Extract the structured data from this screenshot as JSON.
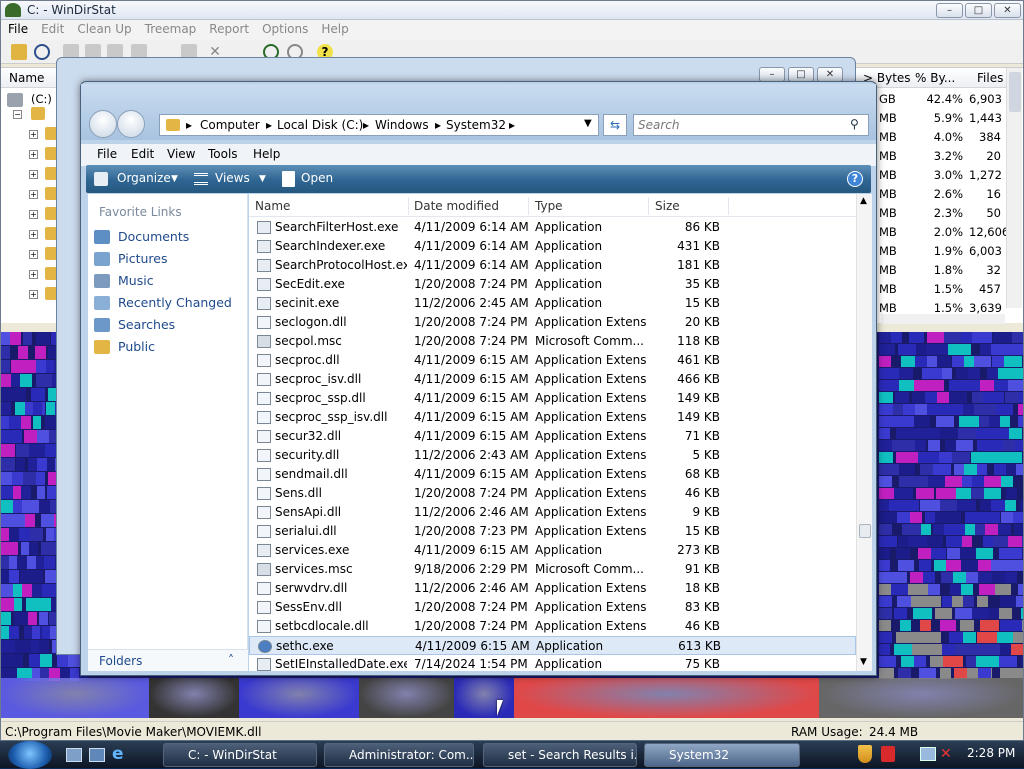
{
  "windirstat": {
    "title": "C: - WinDirStat",
    "menu": [
      "File",
      "Edit",
      "Clean Up",
      "Treemap",
      "Report",
      "Options",
      "Help"
    ],
    "list_headers": {
      "name": "Name",
      "bytes": "> Bytes",
      "pct_bytes": "% By...",
      "files": "Files"
    },
    "drive": "(C:)",
    "rows": [
      {
        "size": "GB",
        "pct": "42.4%",
        "files": "6,903"
      },
      {
        "size": "MB",
        "pct": "5.9%",
        "files": "1,443"
      },
      {
        "size": "MB",
        "pct": "4.0%",
        "files": "384"
      },
      {
        "size": "MB",
        "pct": "3.2%",
        "files": "20"
      },
      {
        "size": "MB",
        "pct": "3.0%",
        "files": "1,272"
      },
      {
        "size": "MB",
        "pct": "2.6%",
        "files": "16"
      },
      {
        "size": "MB",
        "pct": "2.3%",
        "files": "50"
      },
      {
        "size": "MB",
        "pct": "2.0%",
        "files": "12,606"
      },
      {
        "size": "MB",
        "pct": "1.9%",
        "files": "6,003"
      },
      {
        "size": "MB",
        "pct": "1.8%",
        "files": "32"
      },
      {
        "size": "MB",
        "pct": "1.5%",
        "files": "457"
      },
      {
        "size": "MB",
        "pct": "1.5%",
        "files": "3,639"
      }
    ],
    "status_path": "C:\\Program Files\\Movie Maker\\MOVIEMK.dll",
    "ram_label": "RAM Usage:",
    "ram_value": "24.4 MB"
  },
  "explorer": {
    "breadcrumb": [
      "Computer",
      "Local Disk (C:)",
      "Windows",
      "System32"
    ],
    "search_placeholder": "Search",
    "menu": [
      "File",
      "Edit",
      "View",
      "Tools",
      "Help"
    ],
    "commands": {
      "organize": "Organize",
      "views": "Views",
      "open": "Open"
    },
    "favorite_links_title": "Favorite Links",
    "favorite_links": [
      "Documents",
      "Pictures",
      "Music",
      "Recently Changed",
      "Searches",
      "Public"
    ],
    "folders_label": "Folders",
    "columns": {
      "name": "Name",
      "date": "Date modified",
      "type": "Type",
      "size": "Size"
    },
    "files": [
      {
        "name": "SearchFilterHost.exe",
        "date": "4/11/2009 6:14 AM",
        "type": "Application",
        "size": "86 KB"
      },
      {
        "name": "SearchIndexer.exe",
        "date": "4/11/2009 6:14 AM",
        "type": "Application",
        "size": "431 KB"
      },
      {
        "name": "SearchProtocolHost.exe",
        "date": "4/11/2009 6:14 AM",
        "type": "Application",
        "size": "181 KB"
      },
      {
        "name": "SecEdit.exe",
        "date": "1/20/2008 7:24 PM",
        "type": "Application",
        "size": "35 KB"
      },
      {
        "name": "secinit.exe",
        "date": "11/2/2006 2:45 AM",
        "type": "Application",
        "size": "15 KB"
      },
      {
        "name": "seclogon.dll",
        "date": "1/20/2008 7:24 PM",
        "type": "Application Extens...",
        "size": "20 KB"
      },
      {
        "name": "secpol.msc",
        "date": "1/20/2008 7:24 PM",
        "type": "Microsoft Comm...",
        "size": "118 KB"
      },
      {
        "name": "secproc.dll",
        "date": "4/11/2009 6:15 AM",
        "type": "Application Extens...",
        "size": "461 KB"
      },
      {
        "name": "secproc_isv.dll",
        "date": "4/11/2009 6:15 AM",
        "type": "Application Extens...",
        "size": "466 KB"
      },
      {
        "name": "secproc_ssp.dll",
        "date": "4/11/2009 6:15 AM",
        "type": "Application Extens...",
        "size": "149 KB"
      },
      {
        "name": "secproc_ssp_isv.dll",
        "date": "4/11/2009 6:15 AM",
        "type": "Application Extens...",
        "size": "149 KB"
      },
      {
        "name": "secur32.dll",
        "date": "4/11/2009 6:15 AM",
        "type": "Application Extens...",
        "size": "71 KB"
      },
      {
        "name": "security.dll",
        "date": "11/2/2006 2:43 AM",
        "type": "Application Extens...",
        "size": "5 KB"
      },
      {
        "name": "sendmail.dll",
        "date": "4/11/2009 6:15 AM",
        "type": "Application Extens...",
        "size": "68 KB"
      },
      {
        "name": "Sens.dll",
        "date": "1/20/2008 7:24 PM",
        "type": "Application Extens...",
        "size": "46 KB"
      },
      {
        "name": "SensApi.dll",
        "date": "11/2/2006 2:46 AM",
        "type": "Application Extens...",
        "size": "9 KB"
      },
      {
        "name": "serialui.dll",
        "date": "1/20/2008 7:23 PM",
        "type": "Application Extens...",
        "size": "15 KB"
      },
      {
        "name": "services.exe",
        "date": "4/11/2009 6:15 AM",
        "type": "Application",
        "size": "273 KB"
      },
      {
        "name": "services.msc",
        "date": "9/18/2006 2:29 PM",
        "type": "Microsoft Comm...",
        "size": "91 KB"
      },
      {
        "name": "serwvdrv.dll",
        "date": "11/2/2006 2:46 AM",
        "type": "Application Extens...",
        "size": "18 KB"
      },
      {
        "name": "SessEnv.dll",
        "date": "1/20/2008 7:24 PM",
        "type": "Application Extens...",
        "size": "83 KB"
      },
      {
        "name": "setbcdlocale.dll",
        "date": "1/20/2008 7:24 PM",
        "type": "Application Extens...",
        "size": "46 KB"
      },
      {
        "name": "sethc.exe",
        "date": "4/11/2009 6:15 AM",
        "type": "Application",
        "size": "613 KB",
        "selected": true
      },
      {
        "name": "SetIEInstalledDate.exe",
        "date": "7/14/2024 1:54 PM",
        "type": "Application",
        "size": "75 KB"
      }
    ]
  },
  "taskbar": {
    "tasks": [
      "C: - WinDirStat",
      "Administrator: Com...",
      "set - Search Results i...",
      "System32"
    ],
    "clock": "2:28 PM"
  },
  "colors": {
    "treemap_blue": "#2a2ab8",
    "treemap_magenta": "#c020c0",
    "treemap_cyan": "#10c0c0",
    "treemap_red": "#e04848",
    "selected_row": "#dde9f7"
  }
}
